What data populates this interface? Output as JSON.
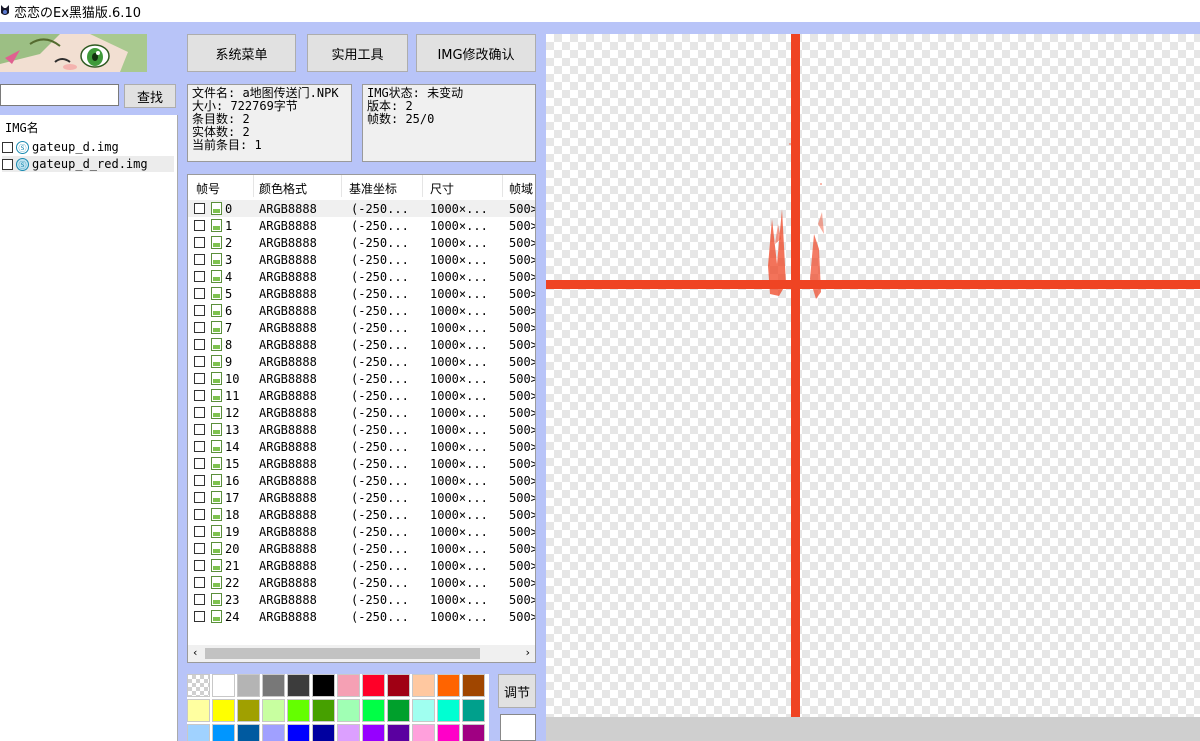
{
  "window": {
    "title": "恋恋のEx黑猫版.6.10"
  },
  "toolbar": {
    "system_menu": "系统菜单",
    "tools": "实用工具",
    "img_confirm": "IMG修改确认"
  },
  "search": {
    "value": "",
    "button": "查找"
  },
  "img_list": {
    "header": "IMG名",
    "items": [
      {
        "name": "gateup_d.img",
        "selected": false
      },
      {
        "name": "gateup_d_red.img",
        "selected": true
      }
    ]
  },
  "file_info": {
    "filename": "文件名: a地图传送门.NPK",
    "size": "大小: 722769字节",
    "entries": "条目数: 2",
    "entities": "实体数: 2",
    "current": "当前条目: 1"
  },
  "img_info": {
    "status": "IMG状态: 未变动",
    "version": "版本: 2",
    "frames": "帧数: 25/0"
  },
  "frame_table": {
    "columns": [
      "帧号",
      "颜色格式",
      "基准坐标",
      "尺寸",
      "帧域"
    ],
    "rows": [
      {
        "id": "0",
        "fmt": "ARGB8888",
        "base": "(-250...",
        "size": "1000×...",
        "field": "500>"
      },
      {
        "id": "1",
        "fmt": "ARGB8888",
        "base": "(-250...",
        "size": "1000×...",
        "field": "500>"
      },
      {
        "id": "2",
        "fmt": "ARGB8888",
        "base": "(-250...",
        "size": "1000×...",
        "field": "500>"
      },
      {
        "id": "3",
        "fmt": "ARGB8888",
        "base": "(-250...",
        "size": "1000×...",
        "field": "500>"
      },
      {
        "id": "4",
        "fmt": "ARGB8888",
        "base": "(-250...",
        "size": "1000×...",
        "field": "500>"
      },
      {
        "id": "5",
        "fmt": "ARGB8888",
        "base": "(-250...",
        "size": "1000×...",
        "field": "500>"
      },
      {
        "id": "6",
        "fmt": "ARGB8888",
        "base": "(-250...",
        "size": "1000×...",
        "field": "500>"
      },
      {
        "id": "7",
        "fmt": "ARGB8888",
        "base": "(-250...",
        "size": "1000×...",
        "field": "500>"
      },
      {
        "id": "8",
        "fmt": "ARGB8888",
        "base": "(-250...",
        "size": "1000×...",
        "field": "500>"
      },
      {
        "id": "9",
        "fmt": "ARGB8888",
        "base": "(-250...",
        "size": "1000×...",
        "field": "500>"
      },
      {
        "id": "10",
        "fmt": "ARGB8888",
        "base": "(-250...",
        "size": "1000×...",
        "field": "500>"
      },
      {
        "id": "11",
        "fmt": "ARGB8888",
        "base": "(-250...",
        "size": "1000×...",
        "field": "500>"
      },
      {
        "id": "12",
        "fmt": "ARGB8888",
        "base": "(-250...",
        "size": "1000×...",
        "field": "500>"
      },
      {
        "id": "13",
        "fmt": "ARGB8888",
        "base": "(-250...",
        "size": "1000×...",
        "field": "500>"
      },
      {
        "id": "14",
        "fmt": "ARGB8888",
        "base": "(-250...",
        "size": "1000×...",
        "field": "500>"
      },
      {
        "id": "15",
        "fmt": "ARGB8888",
        "base": "(-250...",
        "size": "1000×...",
        "field": "500>"
      },
      {
        "id": "16",
        "fmt": "ARGB8888",
        "base": "(-250...",
        "size": "1000×...",
        "field": "500>"
      },
      {
        "id": "17",
        "fmt": "ARGB8888",
        "base": "(-250...",
        "size": "1000×...",
        "field": "500>"
      },
      {
        "id": "18",
        "fmt": "ARGB8888",
        "base": "(-250...",
        "size": "1000×...",
        "field": "500>"
      },
      {
        "id": "19",
        "fmt": "ARGB8888",
        "base": "(-250...",
        "size": "1000×...",
        "field": "500>"
      },
      {
        "id": "20",
        "fmt": "ARGB8888",
        "base": "(-250...",
        "size": "1000×...",
        "field": "500>"
      },
      {
        "id": "21",
        "fmt": "ARGB8888",
        "base": "(-250...",
        "size": "1000×...",
        "field": "500>"
      },
      {
        "id": "22",
        "fmt": "ARGB8888",
        "base": "(-250...",
        "size": "1000×...",
        "field": "500>"
      },
      {
        "id": "23",
        "fmt": "ARGB8888",
        "base": "(-250...",
        "size": "1000×...",
        "field": "500>"
      },
      {
        "id": "24",
        "fmt": "ARGB8888",
        "base": "(-250...",
        "size": "1000×...",
        "field": "500>"
      }
    ]
  },
  "palette": {
    "colors": [
      "checker",
      "#ffffff",
      "#b4b4b4",
      "#787878",
      "#3c3c3c",
      "#000000",
      "#f5a0b4",
      "#ff0028",
      "#a00014",
      "#ffc8a0",
      "#ff6400",
      "#a04600",
      "#ffffa0",
      "#ffff00",
      "#a0a000",
      "#c8ffa0",
      "#64ff00",
      "#46a000",
      "#a0ffb4",
      "#00ff46",
      "#00a02c",
      "#a0fff0",
      "#00ffd2",
      "#00a08c",
      "#a0d2ff",
      "#0096ff",
      "#005aa0",
      "#a0a0ff",
      "#0000ff",
      "#0000a0",
      "#dca0ff",
      "#9600ff",
      "#5a00a0",
      "#ffa0dc",
      "#ff00c8",
      "#a00082"
    ],
    "adjust_button": "调节",
    "current_color": "#ffffff"
  },
  "canvas": {
    "crosshair_color": "#ef4423"
  }
}
